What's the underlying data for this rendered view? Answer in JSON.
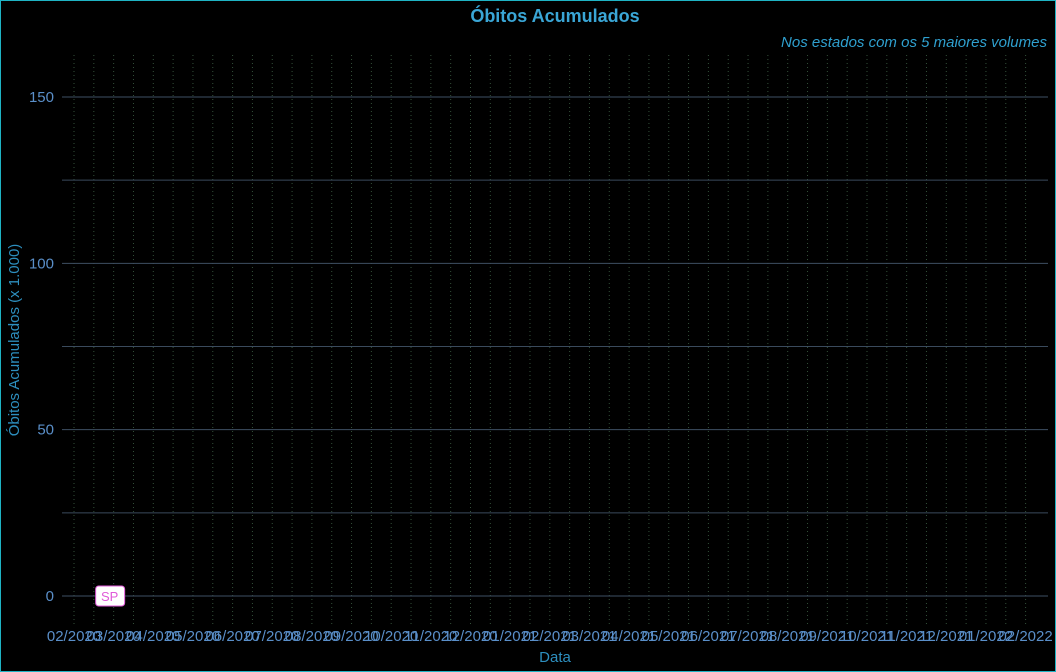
{
  "chart_data": {
    "type": "line",
    "title": "Óbitos Acumulados",
    "subtitle": "Nos estados com os 5 maiores volumes",
    "xlabel": "Data",
    "ylabel": "Óbitos Acumulados (x 1.000)",
    "ylim": [
      -8,
      163
    ],
    "y_major_ticks": [
      0,
      50,
      100,
      150
    ],
    "y_minor_ticks": [
      25,
      75,
      125
    ],
    "x_tick_labels": [
      "02/2020",
      "03/2020",
      "04/2020",
      "05/2020",
      "06/2020",
      "07/2020",
      "08/2020",
      "09/2020",
      "10/2020",
      "11/2020",
      "12/2020",
      "01/2021",
      "02/2021",
      "03/2021",
      "04/2021",
      "05/2021",
      "06/2021",
      "07/2021",
      "08/2021",
      "09/2021",
      "10/2021",
      "11/2021",
      "12/2021",
      "01/2022",
      "02/2022"
    ],
    "grid": true,
    "series": [
      {
        "name": "SP",
        "x": [
          "03/2020"
        ],
        "values": [
          0
        ],
        "color": "#e05ad9"
      }
    ]
  },
  "colors": {
    "background": "#000000",
    "border": "#1fb3c4",
    "title": "#3aa6d6",
    "tick": "#5a8fc9",
    "label_sp": "#e05ad9"
  }
}
